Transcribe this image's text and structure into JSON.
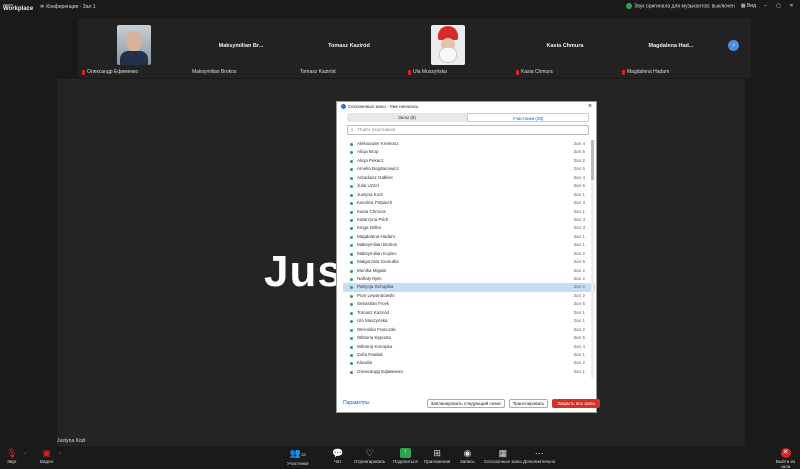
{
  "app": {
    "logo_line1": "zoom",
    "logo_line2": "Workplace",
    "meeting_title": "Конференция - Зал 1",
    "original_sound": "Звук оригинала для музыкантов: выключен",
    "view_label": "Вид"
  },
  "strip": {
    "tiles": [
      {
        "center": "",
        "bottom": "Олександр Ефименко"
      },
      {
        "center": "Maksymilian   Br...",
        "bottom": "Maksymilian Brokos"
      },
      {
        "center": "Tomasz Kaziród",
        "bottom": "Tomasz Kaziród"
      },
      {
        "center": "",
        "bottom": "Ula Muszyńska"
      },
      {
        "center": "Kasia Chmura",
        "bottom": "Kasia Chmura"
      },
      {
        "center": "Magdalena   Had...",
        "bottom": "Magdalena Hadam"
      }
    ]
  },
  "stage": {
    "big_text": "Jus",
    "name": "Justyna Kozł"
  },
  "dialog": {
    "title": "Сессионные залы - Уже началось",
    "tab_rooms": "Залы (6)",
    "tab_participants": "Участники (28)",
    "search_placeholder": "Поиск участников",
    "participants": [
      {
        "name": "Aleksander Krentosz",
        "room": "Зал 4"
      },
      {
        "name": "Alicja Brop",
        "room": "Зал 5"
      },
      {
        "name": "Alicja Pekacz",
        "room": "Зал 2"
      },
      {
        "name": "Amelia Bogdanowicz",
        "room": "Зал 6"
      },
      {
        "name": "Arkadiusz Gałbiec",
        "room": "Зал 4"
      },
      {
        "name": "Julia Uzzel",
        "room": "Зал 6"
      },
      {
        "name": "Justyna Kozł",
        "room": "Зал 1"
      },
      {
        "name": "Karolina Potpiech",
        "room": "Зал 3"
      },
      {
        "name": "Kasia Chmura",
        "room": "Зал 1"
      },
      {
        "name": "Katarzyna Pilch",
        "room": "Зал 4"
      },
      {
        "name": "Kinga Niška",
        "room": "Зал 3"
      },
      {
        "name": "Magdalena Hadam",
        "room": "Зал 1"
      },
      {
        "name": "Maksymilian Brokos",
        "room": "Зал 1"
      },
      {
        "name": "Maksymilian Kopiec",
        "room": "Зал 2"
      },
      {
        "name": "Małgorzata Gumułka",
        "room": "Зал 6"
      },
      {
        "name": "Monika Migała",
        "room": "Зал 2"
      },
      {
        "name": "Naftaly Njeri",
        "room": "Зал 2"
      },
      {
        "name": "Patrycja Ochojska",
        "room": "Зал 2"
      },
      {
        "name": "Piotr Lewandowski",
        "room": "Зал 2"
      },
      {
        "name": "Sebastian Ficek",
        "room": "Зал 6"
      },
      {
        "name": "Tomasz Kaziród",
        "room": "Зал 1"
      },
      {
        "name": "Ula Muszyńska",
        "room": "Зал 1"
      },
      {
        "name": "Weronika Franczak",
        "room": "Зал 2"
      },
      {
        "name": "Wiktoria Kępusta",
        "room": "Зал 5"
      },
      {
        "name": "Wiktoria Konopka",
        "room": "Зал 4"
      },
      {
        "name": "Zofia Pawlak",
        "room": "Зал 1"
      },
      {
        "name": "Klaudia",
        "room": "Зал 2"
      },
      {
        "name": "Олександр Ефименко",
        "room": "Зал 1"
      }
    ],
    "selected_index": 17,
    "params_label": "Параметры",
    "schedule_label": "Запланировать следующий сеанс",
    "broadcast_label": "Транслировать",
    "close_all_label": "Закрыть все залы"
  },
  "toolbar": {
    "items": [
      {
        "label": "Звук",
        "icon": "mic-muted-icon"
      },
      {
        "label": "Видео",
        "icon": "camera-off-icon"
      },
      {
        "label": "Участники",
        "count": "28",
        "icon": "participants-icon"
      },
      {
        "label": "Чат",
        "icon": "chat-icon"
      },
      {
        "label": "Отреагировать",
        "icon": "heart-icon"
      },
      {
        "label": "Поделиться",
        "icon": "share-icon"
      },
      {
        "label": "Приложения",
        "icon": "apps-icon"
      },
      {
        "label": "Запись",
        "icon": "record-icon"
      },
      {
        "label": "Сессионные залы",
        "icon": "breakout-icon"
      },
      {
        "label": "Дополнительно",
        "icon": "more-icon"
      },
      {
        "label": "Выйти из зала",
        "icon": "leave-icon"
      }
    ]
  }
}
